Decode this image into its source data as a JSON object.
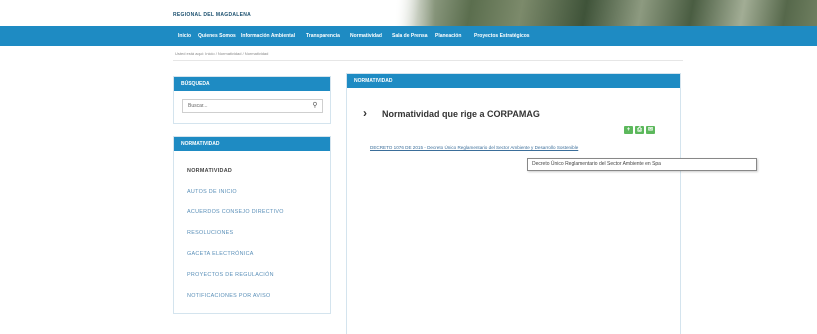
{
  "header": {
    "brand": "REGIONAL DEL MAGDALENA"
  },
  "nav": {
    "items": [
      "Inicio",
      "Quienes Somos",
      "Información Ambiental",
      "Transparencia",
      "Normatividad",
      "Sala de Prensa",
      "Planeación",
      "Proyectos Estratégicos"
    ]
  },
  "breadcrumb": "Usted está aquí: Inicio / Normatividad / Normatividad",
  "search_widget": {
    "title": "BÚSQUEDA",
    "placeholder": "Buscar...",
    "icon": "search-icon"
  },
  "normatividad_widget": {
    "title": "NORMATIVIDAD",
    "items": [
      "NORMATIVIDAD",
      "AUTOS DE INICIO",
      "ACUERDOS CONSEJO DIRECTIVO",
      "RESOLUCIONES",
      "GACETA ELECTRÓNICA",
      "PROYECTOS DE REGULACIÓN",
      "NOTIFICACIONES POR AVISO"
    ]
  },
  "main": {
    "header": "NORMATIVIDAD",
    "title": "Normatividad que rige a CORPAMAG",
    "share_icons": [
      "share-icon",
      "print-icon",
      "email-icon"
    ],
    "link": "DECRETO 1076 DE 2015 - Decreto Único Reglamentario del Sector Ambiente y Desarrollo Sostenible",
    "tooltip": "Decreto Único Reglamentario del Sector Ambiente en Spa"
  },
  "colors": {
    "accent": "#1e8bc3",
    "link": "#3b6e9a",
    "share_green": "#5cb85c"
  }
}
